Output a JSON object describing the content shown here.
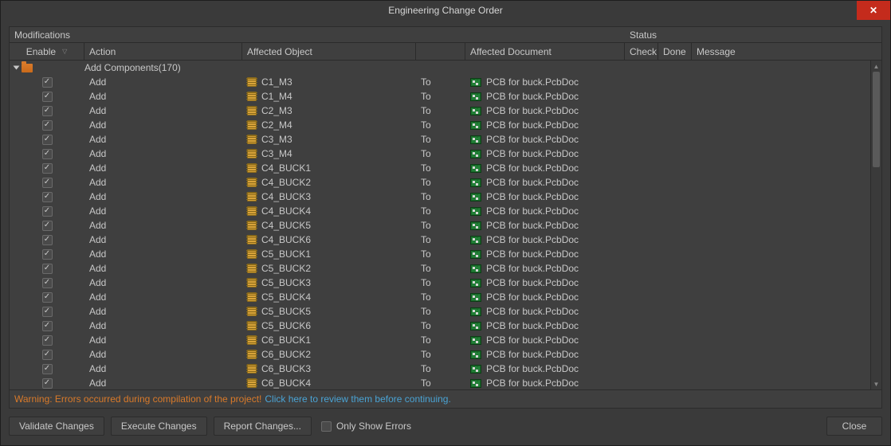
{
  "window": {
    "title": "Engineering Change Order"
  },
  "sections": {
    "modifications": "Modifications",
    "status": "Status"
  },
  "columns": {
    "enable": "Enable",
    "action": "Action",
    "affected_object": "Affected Object",
    "affected_document": "Affected Document",
    "check": "Check",
    "done": "Done",
    "message": "Message"
  },
  "group": {
    "label": "Add Components(170)"
  },
  "to_label": "To",
  "target_doc": "PCB for buck.PcbDoc",
  "rows": [
    {
      "action": "Add",
      "object": "C1_M3"
    },
    {
      "action": "Add",
      "object": "C1_M4"
    },
    {
      "action": "Add",
      "object": "C2_M3"
    },
    {
      "action": "Add",
      "object": "C2_M4"
    },
    {
      "action": "Add",
      "object": "C3_M3"
    },
    {
      "action": "Add",
      "object": "C3_M4"
    },
    {
      "action": "Add",
      "object": "C4_BUCK1"
    },
    {
      "action": "Add",
      "object": "C4_BUCK2"
    },
    {
      "action": "Add",
      "object": "C4_BUCK3"
    },
    {
      "action": "Add",
      "object": "C4_BUCK4"
    },
    {
      "action": "Add",
      "object": "C4_BUCK5"
    },
    {
      "action": "Add",
      "object": "C4_BUCK6"
    },
    {
      "action": "Add",
      "object": "C5_BUCK1"
    },
    {
      "action": "Add",
      "object": "C5_BUCK2"
    },
    {
      "action": "Add",
      "object": "C5_BUCK3"
    },
    {
      "action": "Add",
      "object": "C5_BUCK4"
    },
    {
      "action": "Add",
      "object": "C5_BUCK5"
    },
    {
      "action": "Add",
      "object": "C5_BUCK6"
    },
    {
      "action": "Add",
      "object": "C6_BUCK1"
    },
    {
      "action": "Add",
      "object": "C6_BUCK2"
    },
    {
      "action": "Add",
      "object": "C6_BUCK3"
    },
    {
      "action": "Add",
      "object": "C6_BUCK4"
    }
  ],
  "warning": {
    "text": "Warning: Errors occurred during compilation of the project!",
    "link": "Click here to review them before continuing."
  },
  "buttons": {
    "validate": "Validate Changes",
    "execute": "Execute Changes",
    "report": "Report Changes...",
    "only_errors": "Only Show Errors",
    "close": "Close"
  }
}
